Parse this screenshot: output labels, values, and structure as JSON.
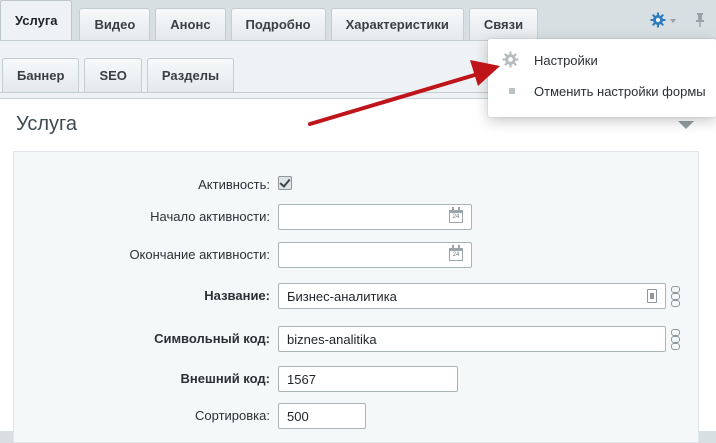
{
  "tabs_row1": [
    {
      "label": "Услуга",
      "active": true
    },
    {
      "label": "Видео"
    },
    {
      "label": "Анонс"
    },
    {
      "label": "Подробно"
    },
    {
      "label": "Характеристики"
    },
    {
      "label": "Связи"
    }
  ],
  "tabs_row2": [
    {
      "label": "Баннер"
    },
    {
      "label": "SEO"
    },
    {
      "label": "Разделы"
    }
  ],
  "section": {
    "title": "Услуга"
  },
  "form": {
    "active": {
      "label": "Активность:",
      "checked": true
    },
    "start": {
      "label": "Начало активности:",
      "value": "",
      "calendar_day": "24"
    },
    "end": {
      "label": "Окончание активности:",
      "value": "",
      "calendar_day": "24"
    },
    "name": {
      "label": "Название:",
      "value": "Бизнес-аналитика"
    },
    "code": {
      "label": "Символьный код:",
      "value": "biznes-analitika"
    },
    "xml_id": {
      "label": "Внешний код:",
      "value": "1567"
    },
    "sort": {
      "label": "Сортировка:",
      "value": "500"
    }
  },
  "settings_menu": {
    "items": [
      {
        "label": "Настройки",
        "icon": "gear-icon"
      },
      {
        "label": "Отменить настройки формы",
        "icon": "bullet-icon"
      }
    ]
  },
  "colors": {
    "accent_gear": "#2d7bc0",
    "arrow": "#c0141b"
  }
}
